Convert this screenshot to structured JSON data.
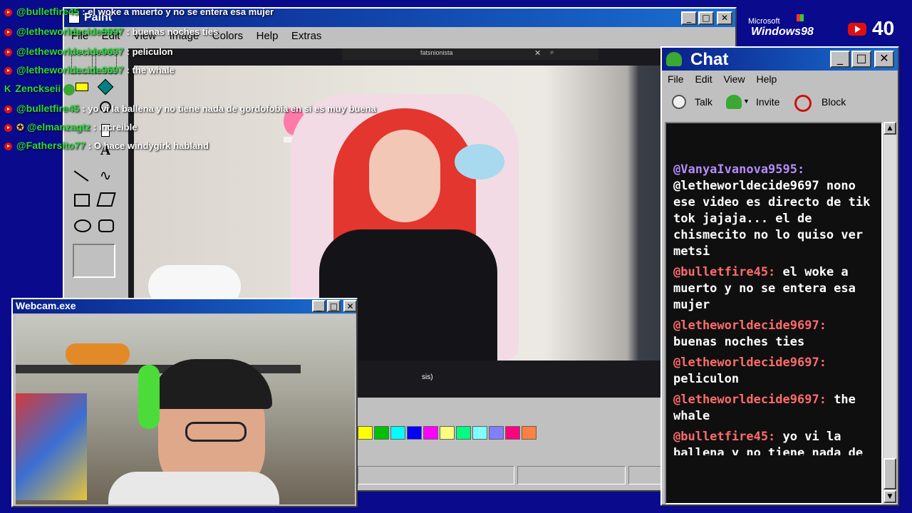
{
  "overlay_chat": [
    {
      "user": "@bulletfire45",
      "msg": "el woke a muerto y no se entera esa mujer",
      "badge": "youtube"
    },
    {
      "user": "@letheworldecide9697",
      "msg": "buenas noches ties",
      "badge": "youtube"
    },
    {
      "user": "@letheworldecide9697",
      "msg": "peliculon",
      "badge": "youtube"
    },
    {
      "user": "@letheworldecide9697",
      "msg": "the whale",
      "badge": "youtube"
    },
    {
      "user": "Zenckseii",
      "msg": "",
      "badge": "kick"
    },
    {
      "user": "@bulletfire45",
      "msg": "yo vi la ballena y no tiene nada de gordofobia en si es muy buena",
      "badge": "youtube"
    },
    {
      "user": "@elmanzagtz",
      "msg": "increible",
      "badge": "youtube"
    },
    {
      "user": "@Fathersito77",
      "msg": "O hace windygirk habland",
      "badge": "youtube"
    }
  ],
  "paint": {
    "title": "Paint",
    "menu": [
      "File",
      "Edit",
      "View",
      "Image",
      "Colors",
      "Help",
      "Extras"
    ],
    "search_text": "fatsnionista",
    "caption_fragment": "sis)",
    "palette": [
      "#ffff00",
      "#00c000",
      "#00ffff",
      "#0000ff",
      "#ff00ff",
      "#ffff80",
      "#00ff80",
      "#80ffff",
      "#8080ff",
      "#ff0080",
      "#ff8040"
    ]
  },
  "webcam": {
    "title": "Webcam.exe"
  },
  "chat_window": {
    "title": "Chat",
    "menu": [
      "File",
      "Edit",
      "View",
      "Help"
    ],
    "toolbar": {
      "talk": "Talk",
      "invite": "Invite",
      "block": "Block"
    },
    "messages": [
      {
        "user": "@VanyaIvanova9595:",
        "text": "@letheworldecide9697 nono ese video es directo de tik tok jajaja... el de chismecito no lo quiso ver metsi",
        "color": "purple"
      },
      {
        "user": "@bulletfire45:",
        "text": "el woke a muerto y no se entera esa mujer",
        "color": "red"
      },
      {
        "user": "@letheworldecide9697:",
        "text": "buenas noches ties",
        "color": "red"
      },
      {
        "user": "@letheworldecide9697:",
        "text": "peliculon",
        "color": "red"
      },
      {
        "user": "@letheworldecide9697:",
        "text": "the whale",
        "color": "red"
      },
      {
        "user": "@bulletfire45:",
        "text": "yo vi la ballena y no tiene nada de",
        "color": "red"
      }
    ]
  },
  "branding": {
    "ms_line1": "Microsoft",
    "ms_line2": "Windows98"
  },
  "viewer_count": "40"
}
